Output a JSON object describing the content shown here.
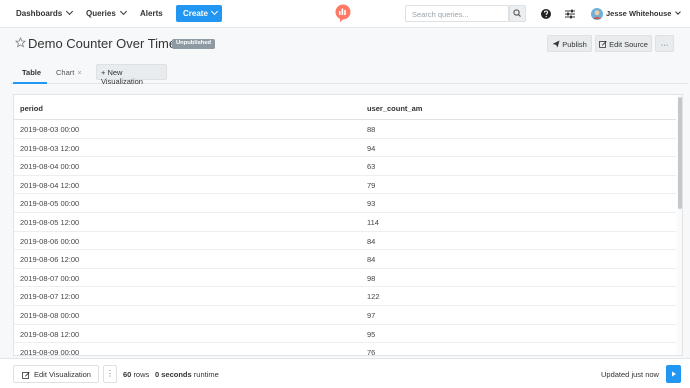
{
  "nav": {
    "dashboards": "Dashboards",
    "queries": "Queries",
    "alerts": "Alerts",
    "create": "Create",
    "search_placeholder": "Search queries...",
    "user_name": "Jesse Whitehouse"
  },
  "header": {
    "title": "Demo Counter Over Time",
    "badge": "Unpublished",
    "publish": "Publish",
    "edit_source": "Edit Source",
    "more": "···"
  },
  "tabs": {
    "table": "Table",
    "chart": "Chart",
    "chart_close": "×",
    "new_visualization": "+ New Visualization"
  },
  "table": {
    "columns": [
      "period",
      "user_count_am"
    ],
    "rows": [
      [
        "2019-08-03 00:00",
        "88"
      ],
      [
        "2019-08-03 12:00",
        "94"
      ],
      [
        "2019-08-04 00:00",
        "63"
      ],
      [
        "2019-08-04 12:00",
        "79"
      ],
      [
        "2019-08-05 00:00",
        "93"
      ],
      [
        "2019-08-05 12:00",
        "114"
      ],
      [
        "2019-08-06 00:00",
        "84"
      ],
      [
        "2019-08-06 12:00",
        "84"
      ],
      [
        "2019-08-07 00:00",
        "98"
      ],
      [
        "2019-08-07 12:00",
        "122"
      ],
      [
        "2019-08-08 00:00",
        "97"
      ],
      [
        "2019-08-08 12:00",
        "95"
      ],
      [
        "2019-08-09 00:00",
        "76"
      ]
    ]
  },
  "footer": {
    "edit_visualization": "Edit Visualization",
    "more": "⋮",
    "rows_count": "60",
    "rows_label": "rows",
    "runtime_value": "0 seconds",
    "runtime_label": "runtime",
    "updated": "Updated just now"
  },
  "colors": {
    "accent": "#2196f3",
    "logo": "#ff7964",
    "badge": "#8e9aa2"
  },
  "icons": {
    "search": "magnifier",
    "help": "question-circle",
    "settings": "sliders",
    "star": "star-outline",
    "publish": "paper-plane",
    "edit_source": "pencil-square",
    "edit_vis": "pencil-square",
    "execute": "play"
  }
}
